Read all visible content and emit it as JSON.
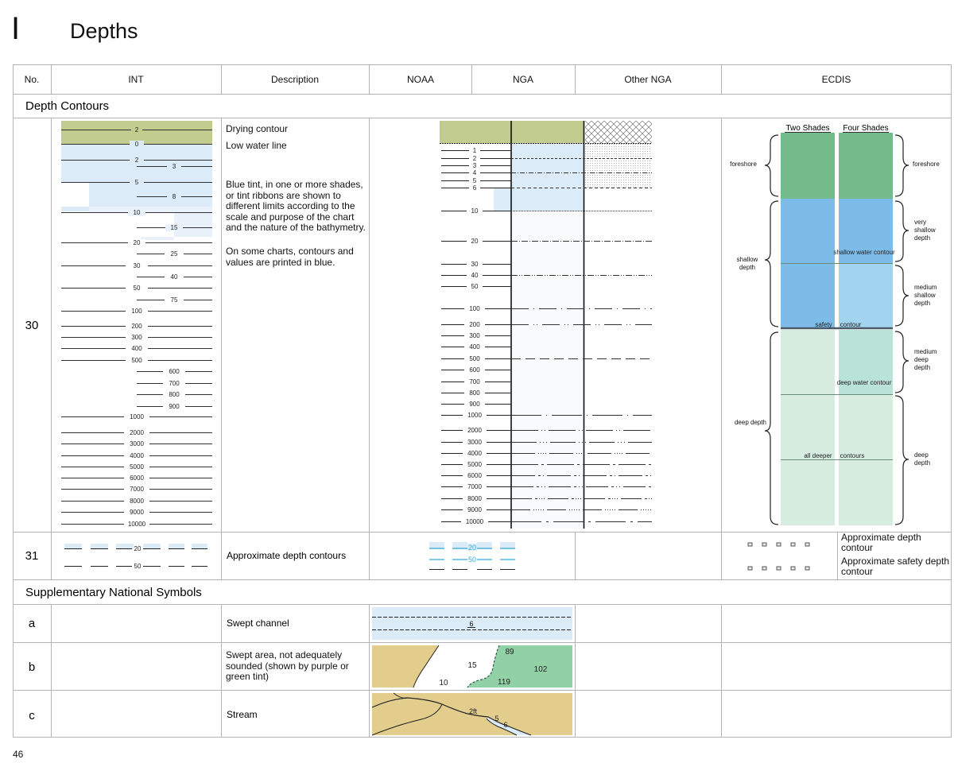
{
  "header": {
    "letter": "I",
    "title": "Depths"
  },
  "page_number": "46",
  "columns": [
    "No.",
    "INT",
    "Description",
    "NOAA",
    "NGA",
    "Other NGA",
    "ECDIS"
  ],
  "section_depth_contours": "Depth Contours",
  "section_supplementary": "Supplementary National Symbols",
  "row30": {
    "no": "30",
    "desc": [
      "Drying contour",
      "Low water line",
      "Blue tint, in one or more shades, or tint ribbons are shown to different limits according to the scale and purpose of the chart and the nature of the bathymetry.",
      "On some charts, contours and values are printed in blue."
    ],
    "int_labels_left": [
      "2",
      "0",
      "2",
      "5",
      "10",
      "20",
      "30",
      "50",
      "100",
      "200",
      "300",
      "400",
      "500",
      "1000",
      "2000",
      "3000",
      "4000",
      "5000",
      "6000",
      "7000",
      "8000",
      "9000",
      "10000"
    ],
    "int_labels_right": [
      "3",
      "8",
      "15",
      "25",
      "40",
      "75",
      "600",
      "700",
      "800",
      "900"
    ],
    "noaa_labels": [
      "1",
      "2",
      "3",
      "4",
      "5",
      "6",
      "10",
      "20",
      "30",
      "40",
      "50",
      "100",
      "200",
      "300",
      "400",
      "500",
      "600",
      "700",
      "800",
      "900",
      "1000",
      "2000",
      "3000",
      "4000",
      "5000",
      "6000",
      "7000",
      "8000",
      "9000",
      "10000"
    ],
    "ecdis": {
      "col_two": "Two Shades",
      "col_four": "Four Shades",
      "left_braces": [
        "foreshore",
        "shallow depth",
        "deep depth"
      ],
      "right_braces": [
        "foreshore",
        "very shallow depth",
        "medium shallow depth",
        "medium deep depth",
        "deep depth"
      ],
      "shallow_water_contour": "shallow water contour",
      "safety": "safety",
      "contour": "contour",
      "deep_water_contour": "deep water contour",
      "all_deeper": "all deeper",
      "contours": "contours"
    }
  },
  "row31": {
    "no": "31",
    "desc": "Approximate depth contours",
    "int_values": [
      "20",
      "50"
    ],
    "noaa_values": [
      "20",
      "50"
    ],
    "ecdis_labels": [
      "Approximate depth contour",
      "Approximate safety depth contour"
    ]
  },
  "row_a": {
    "no": "a",
    "desc": "Swept channel",
    "sounding": "6"
  },
  "row_b": {
    "no": "b",
    "desc": "Swept area, not adequately sounded (shown by purple or green tint)",
    "soundings": [
      "89",
      "102",
      "15",
      "10",
      "119"
    ]
  },
  "row_c": {
    "no": "c",
    "desc": "Stream",
    "labels": [
      "2ft",
      "5",
      "6"
    ]
  },
  "colors": {
    "drying": "#c2cc8f",
    "tint": "#dcebf8",
    "foreshore": "#74bb8c",
    "shallow_dark": "#7dbce8",
    "shallow_light": "#a2d4ef",
    "deep_a": "#b9e2d8",
    "deep_b": "#d6ede0",
    "land": "#e2cd8c",
    "green_area": "#92d1a6",
    "blue_text": "#35a9d9"
  }
}
